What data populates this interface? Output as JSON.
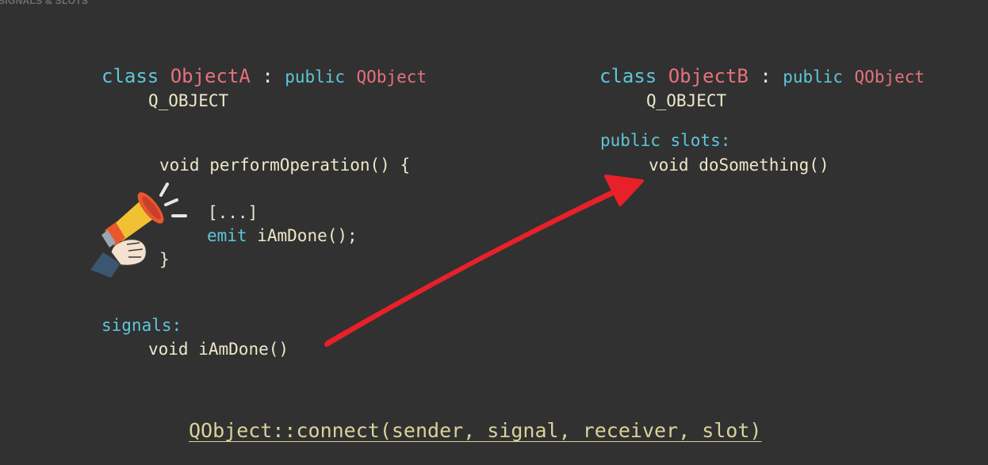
{
  "header": {
    "label": "SIGNALS & SLOTS"
  },
  "object_a": {
    "class_kw": "class",
    "class_name": "ObjectA",
    "colon": ":",
    "public_kw": "public",
    "base": "QObject",
    "macro": "Q_OBJECT",
    "method_void": "void",
    "method_sig": "performOperation() {",
    "ellipsis": "[...]",
    "emit_kw": "emit",
    "emit_call": "iAmDone();",
    "close_brace": "}",
    "signals_kw": "signals:",
    "signal_void": "void",
    "signal_name": "iAmDone()"
  },
  "object_b": {
    "class_kw": "class",
    "class_name": "ObjectB",
    "colon": ":",
    "public_kw": "public",
    "base": "QObject",
    "macro": "Q_OBJECT",
    "slots_kw": "public slots:",
    "slot_void": "void",
    "slot_name": "doSomething()"
  },
  "footer": {
    "connect_text": "QObject::connect(sender, signal, receiver, slot)"
  },
  "icons": {
    "megaphone": "megaphone-icon"
  },
  "colors": {
    "background": "#313131",
    "keyword": "#5fc6d9",
    "class_name": "#e8717c",
    "text": "#ece8c8",
    "arrow": "#e8202a",
    "connect": "#d8d39a"
  }
}
